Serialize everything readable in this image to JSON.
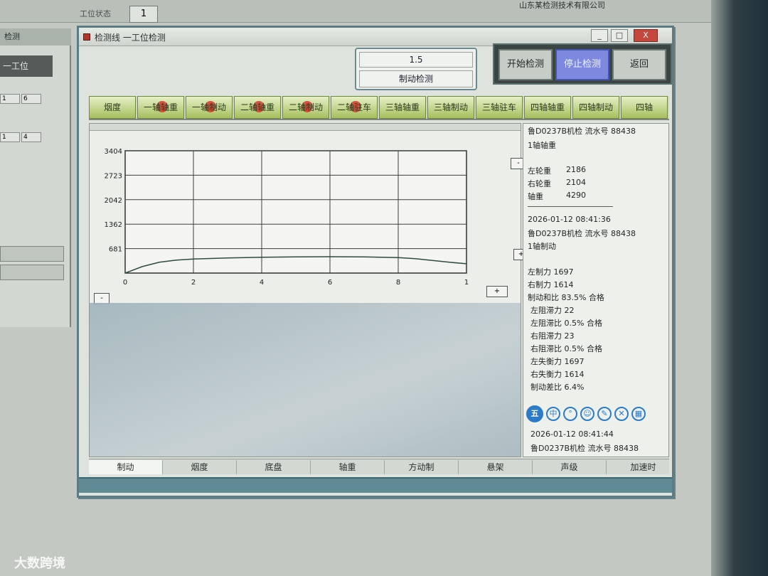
{
  "desktop": {
    "status_tab_label": "工位状态",
    "status_icon_text": "1",
    "company_text": "山东某检测技术有限公司",
    "bg_window_title": "检测",
    "bg_station": "一工位",
    "bg_rows": [
      "1",
      "6",
      "1",
      "4"
    ]
  },
  "window": {
    "title": "检测线 一工位检测",
    "minimize": "_",
    "maximize": "□",
    "close": "X"
  },
  "speed": {
    "value": "1.5",
    "label": "制动检测"
  },
  "controls": {
    "start": "开始检测",
    "stop": "停止检测",
    "back": "返回"
  },
  "process_tabs": [
    {
      "label": "烟度",
      "alert": false
    },
    {
      "label": "一轴轴重",
      "alert": true
    },
    {
      "label": "一轴制动",
      "alert": true
    },
    {
      "label": "二轴轴重",
      "alert": true
    },
    {
      "label": "二轴制动",
      "alert": true
    },
    {
      "label": "二轴驻车",
      "alert": true
    },
    {
      "label": "三轴轴重",
      "alert": false
    },
    {
      "label": "三轴制动",
      "alert": false
    },
    {
      "label": "三轴驻车",
      "alert": false
    },
    {
      "label": "四轴轴重",
      "alert": false
    },
    {
      "label": "四轴制动",
      "alert": false
    },
    {
      "label": "四轴",
      "alert": false
    }
  ],
  "chart_data": {
    "type": "line",
    "title": "",
    "xlabel": "",
    "ylabel": "",
    "x_ticks": [
      "0",
      "2",
      "4",
      "6",
      "8",
      "1"
    ],
    "y_ticks": [
      "3404",
      "2723",
      "2042",
      "1362",
      "681"
    ],
    "xlim": [
      0,
      10
    ],
    "ylim": [
      0,
      3404
    ],
    "grid": true,
    "series": [
      {
        "x": [
          0,
          0.5,
          1,
          1.5,
          2,
          3,
          4,
          5,
          6,
          7,
          8,
          8.5,
          9,
          9.5,
          10
        ],
        "y": [
          0,
          180,
          300,
          360,
          390,
          420,
          440,
          450,
          455,
          450,
          430,
          400,
          350,
          300,
          260
        ]
      }
    ]
  },
  "chart_buttons": {
    "top_right": "-",
    "mid_right": "+",
    "bottom_left": "-",
    "bottom_right": "+"
  },
  "log": {
    "header": "鲁D0237B机检 流水号 88438",
    "axis1_title": "1轴轴重",
    "left_wheel_label": "左轮重",
    "left_wheel_value": "2186",
    "right_wheel_label": "右轮重",
    "right_wheel_value": "2104",
    "axle_label": "轴重",
    "axle_value": "4290",
    "time1": "2026-01-12 08:41:36",
    "record2": "鲁D0237B机检 流水号 88438",
    "axis1_brake_title": "1轴制动",
    "left_brake": "左制力 1697",
    "right_brake": "右制力 1614",
    "brake_ratio": "制动和比 83.5% 合格",
    "left_drag": "左阻滞力 22",
    "left_drag_ratio": "左阻滞比 0.5% 合格",
    "right_drag": "右阻滞力 23",
    "right_drag_ratio": "右阻滞比 0.5% 合格",
    "left_diff": "左失衡力 1697",
    "right_diff": "右失衡力 1614",
    "diff_ratio": "制动差比 6.4%",
    "time2": "2026-01-12 08:41:44",
    "record3": "鲁D0237B机检 流水号 88438"
  },
  "bottom_tabs": [
    "制动",
    "烟度",
    "底盘",
    "轴重",
    "方动制",
    "悬架",
    "声级",
    "加速时"
  ],
  "watermark": "大数跨境"
}
